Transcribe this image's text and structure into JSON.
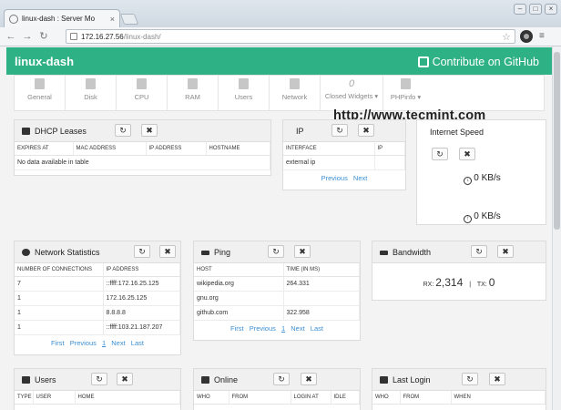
{
  "browser": {
    "tab_title": "linux-dash : Server Mo",
    "url_host": "172.16.27.56",
    "url_path": "/linux-dash/"
  },
  "header": {
    "brand": "linux-dash",
    "github": "Contribute on GitHub"
  },
  "nav": [
    "General",
    "Disk",
    "CPU",
    "RAM",
    "Users",
    "Network"
  ],
  "closed_widgets": {
    "count": "0",
    "label": "Closed Widgets ▾"
  },
  "phpinfo": "PHPinfo ▾",
  "watermark": "http://www.tecmint.com",
  "dhcp": {
    "title": "DHCP Leases",
    "columns": [
      "EXPIRES AT",
      "MAC ADDRESS",
      "IP ADDRESS",
      "HOSTNAME"
    ],
    "empty": "No data available in table"
  },
  "ip": {
    "title": "IP",
    "columns": [
      "INTERFACE",
      "IP"
    ],
    "rows": [
      [
        "external ip",
        ""
      ]
    ],
    "pager": {
      "prev": "Previous",
      "next": "Next"
    }
  },
  "speed": {
    "title": "Internet Speed",
    "down": "0 KB/s",
    "up": "0 KB/s"
  },
  "netstat": {
    "title": "Network Statistics",
    "columns": [
      "NUMBER OF CONNECTIONS",
      "IP ADDRESS"
    ],
    "rows": [
      [
        "7",
        "::ffff:172.16.25.125"
      ],
      [
        "1",
        "172.16.25.125"
      ],
      [
        "1",
        "8.8.8.8"
      ],
      [
        "1",
        "::ffff:103.21.187.207"
      ]
    ],
    "pager": {
      "first": "First",
      "prev": "Previous",
      "page": "1",
      "next": "Next",
      "last": "Last"
    }
  },
  "ping": {
    "title": "Ping",
    "columns": [
      "HOST",
      "TIME (IN MS)"
    ],
    "rows": [
      [
        "wikipedia.org",
        "264.331"
      ],
      [
        "gnu.org",
        ""
      ],
      [
        "github.com",
        "322.958"
      ]
    ],
    "pager": {
      "first": "First",
      "prev": "Previous",
      "page": "1",
      "next": "Next",
      "last": "Last"
    }
  },
  "bandwidth": {
    "title": "Bandwidth",
    "rx_label": "RX:",
    "rx": "2,314",
    "sep": "|",
    "tx_label": "TX:",
    "tx": "0"
  },
  "users": {
    "title": "Users",
    "columns": [
      "TYPE",
      "USER",
      "HOME"
    ]
  },
  "online": {
    "title": "Online",
    "columns": [
      "WHO",
      "FROM",
      "LOGIN AT",
      "IDLE"
    ]
  },
  "lastlogin": {
    "title": "Last Login",
    "columns": [
      "WHO",
      "FROM",
      "WHEN"
    ]
  },
  "icons": {
    "refresh": "↻",
    "close": "✖"
  }
}
